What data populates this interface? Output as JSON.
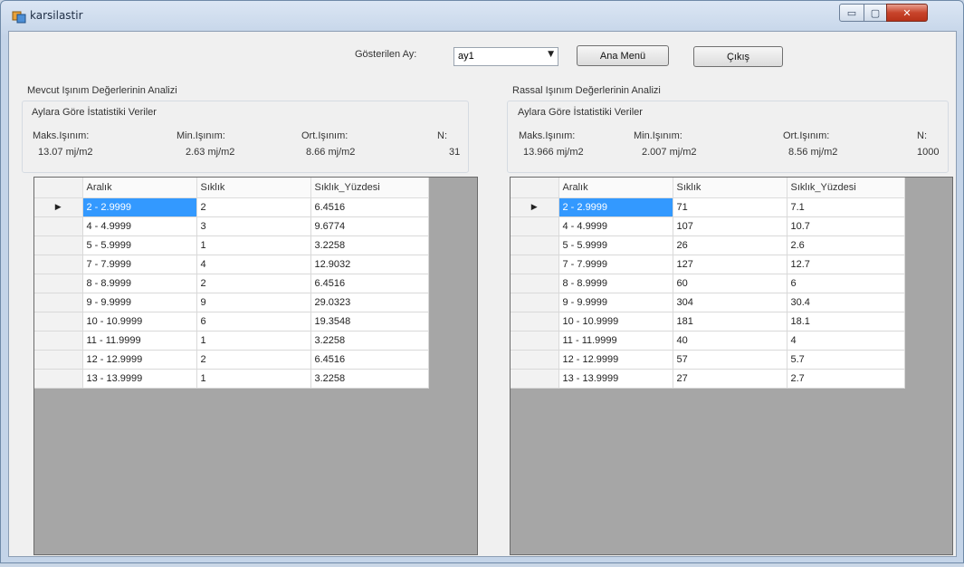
{
  "window": {
    "title": "karsilastir",
    "min_symbol": "▭",
    "max_symbol": "▢",
    "close_symbol": "✕"
  },
  "top": {
    "month_label": "Gösterilen Ay:",
    "month_value": "ay1",
    "main_menu_button": "Ana Menü",
    "exit_button": "Çıkış"
  },
  "left": {
    "section_title": "Mevcut Işınım Değerlerinin Analizi",
    "group_title": "Aylara Göre İstatistiki Veriler",
    "stats": [
      {
        "label": "Maks.Işınım:",
        "value": "13.07 mj/m2"
      },
      {
        "label": "Min.Işınım:",
        "value": "2.63 mj/m2"
      },
      {
        "label": "Ort.Işınım:",
        "value": "8.66 mj/m2"
      },
      {
        "label": "N:",
        "value": "31"
      }
    ],
    "columns": [
      "Aralık",
      "Sıklık",
      "Sıklık_Yüzdesi"
    ],
    "rows": [
      [
        "2 - 2.9999",
        "2",
        "6.4516"
      ],
      [
        "4 - 4.9999",
        "3",
        "9.6774"
      ],
      [
        "5 - 5.9999",
        "1",
        "3.2258"
      ],
      [
        "7 - 7.9999",
        "4",
        "12.9032"
      ],
      [
        "8 - 8.9999",
        "2",
        "6.4516"
      ],
      [
        "9 - 9.9999",
        "9",
        "29.0323"
      ],
      [
        "10 - 10.9999",
        "6",
        "19.3548"
      ],
      [
        "11 - 11.9999",
        "1",
        "3.2258"
      ],
      [
        "12 - 12.9999",
        "2",
        "6.4516"
      ],
      [
        "13 - 13.9999",
        "1",
        "3.2258"
      ]
    ]
  },
  "right": {
    "section_title": "Rassal Işınım Değerlerinin Analizi",
    "group_title": "Aylara Göre İstatistiki Veriler",
    "stats": [
      {
        "label": "Maks.Işınım:",
        "value": "13.966 mj/m2"
      },
      {
        "label": "Min.Işınım:",
        "value": "2.007 mj/m2"
      },
      {
        "label": "Ort.Işınım:",
        "value": "8.56 mj/m2"
      },
      {
        "label": "N:",
        "value": "1000"
      }
    ],
    "columns": [
      "Aralık",
      "Sıklık",
      "Sıklık_Yüzdesi"
    ],
    "rows": [
      [
        "2 - 2.9999",
        "71",
        "7.1"
      ],
      [
        "4 - 4.9999",
        "107",
        "10.7"
      ],
      [
        "5 - 5.9999",
        "26",
        "2.6"
      ],
      [
        "7 - 7.9999",
        "127",
        "12.7"
      ],
      [
        "8 - 8.9999",
        "60",
        "6"
      ],
      [
        "9 - 9.9999",
        "304",
        "30.4"
      ],
      [
        "10 - 10.9999",
        "181",
        "18.1"
      ],
      [
        "11 - 11.9999",
        "40",
        "4"
      ],
      [
        "12 - 12.9999",
        "57",
        "5.7"
      ],
      [
        "13 - 13.9999",
        "27",
        "2.7"
      ]
    ]
  },
  "icons": {
    "row_pointer": "▶",
    "dropdown": "▼"
  }
}
